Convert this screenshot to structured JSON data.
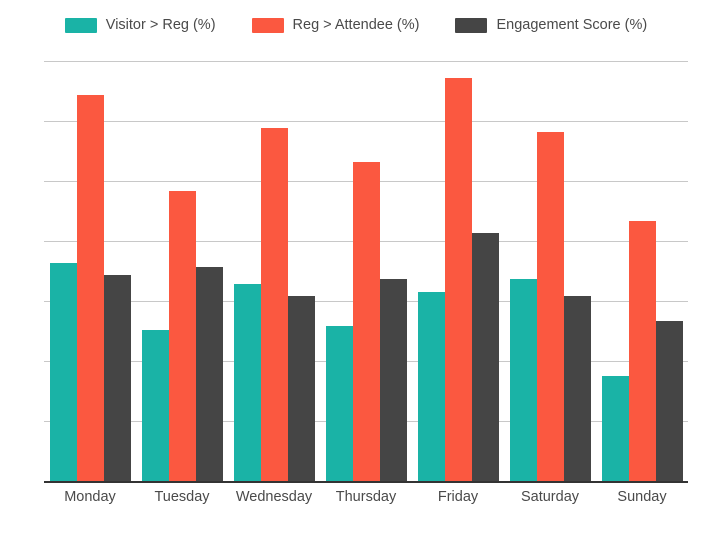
{
  "legend": {
    "position": "top-center",
    "items": [
      {
        "label": "Visitor > Reg (%)",
        "color": "#1ab3a6",
        "swatch_name": "legend-swatch-visitor-reg"
      },
      {
        "label": "Reg > Attendee (%)",
        "color": "#fb5840",
        "swatch_name": "legend-swatch-reg-attendee"
      },
      {
        "label": "Engagement Score (%)",
        "color": "#454545",
        "swatch_name": "legend-swatch-engagement-score"
      }
    ]
  },
  "axis": {
    "x_tick_labels": [
      "Monday",
      "Tuesday",
      "Wednesday",
      "Thursday",
      "Friday",
      "Saturday",
      "Sunday"
    ],
    "y_tick_labels": [],
    "gridline_count": 7
  },
  "chart_data": {
    "type": "bar",
    "title": "",
    "subtitle": "",
    "xlabel": "",
    "ylabel": "",
    "ylim": [
      0,
      100
    ],
    "grid": true,
    "legend_position": "top-center",
    "categories": [
      "Monday",
      "Tuesday",
      "Wednesday",
      "Thursday",
      "Friday",
      "Saturday",
      "Sunday"
    ],
    "series": [
      {
        "name": "Visitor > Reg (%)",
        "color": "#1ab3a6",
        "values": [
          52,
          36,
          47,
          37,
          45,
          48,
          25
        ]
      },
      {
        "name": "Reg > Attendee (%)",
        "color": "#fb5840",
        "values": [
          92,
          69,
          84,
          76,
          96,
          83,
          62
        ]
      },
      {
        "name": "Engagement Score (%)",
        "color": "#454545",
        "values": [
          49,
          51,
          44,
          48,
          59,
          44,
          38
        ]
      }
    ]
  }
}
